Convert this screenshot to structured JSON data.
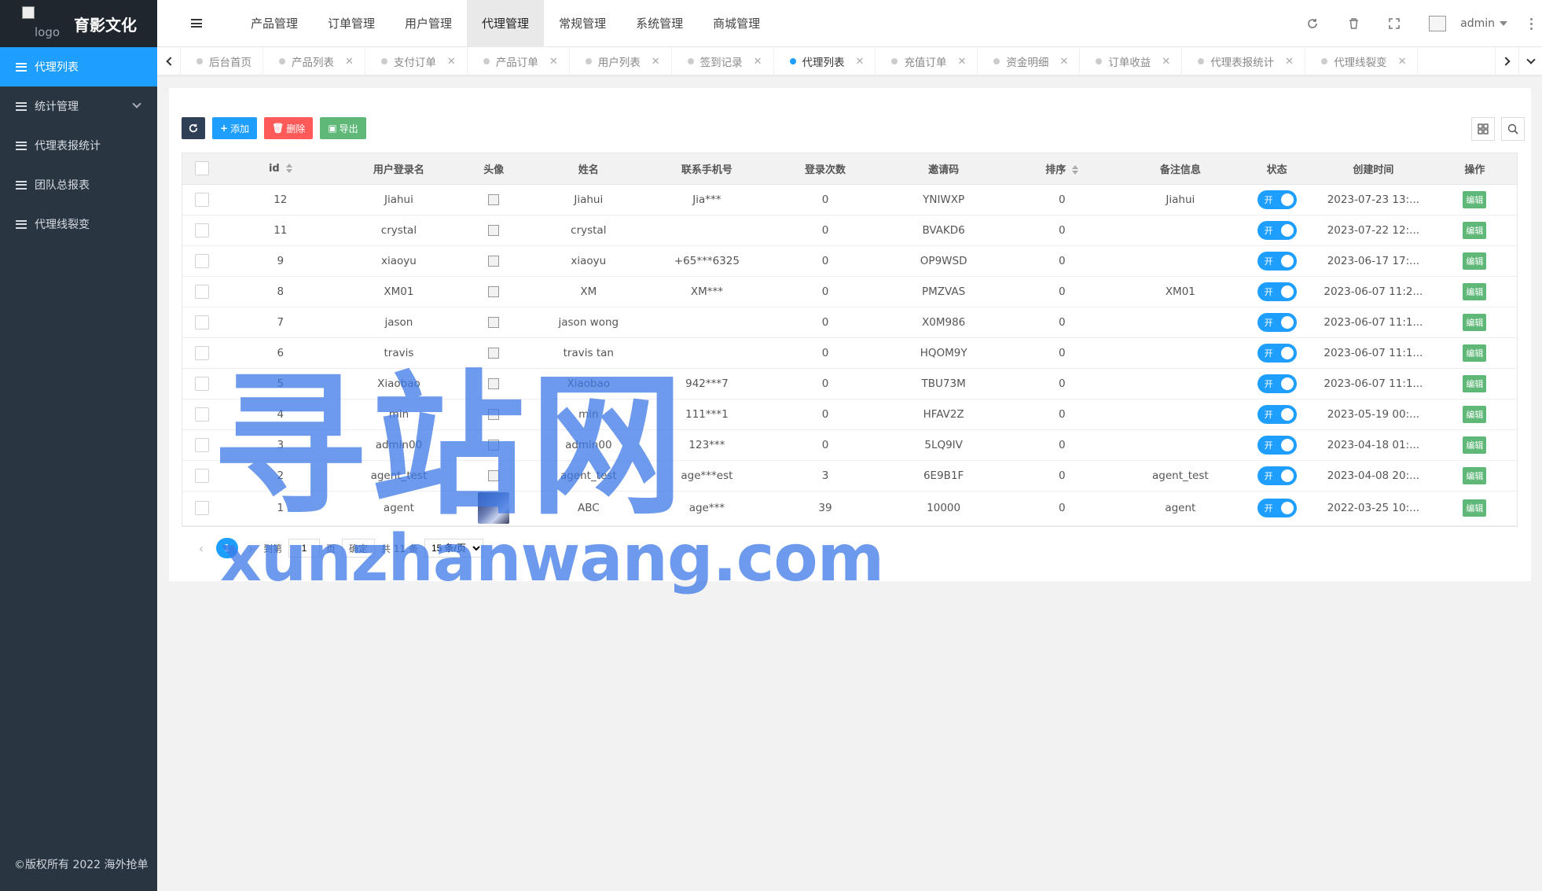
{
  "brand": {
    "logo_alt": "logo",
    "name": "育影文化"
  },
  "sidebar": {
    "items": [
      {
        "label": "代理列表",
        "active": true
      },
      {
        "label": "统计管理",
        "expandable": true
      },
      {
        "label": "代理表报统计"
      },
      {
        "label": "团队总报表"
      },
      {
        "label": "代理线裂变"
      }
    ],
    "copyright": "©版权所有 2022 海外抢单"
  },
  "topnav": {
    "items": [
      "产品管理",
      "订单管理",
      "用户管理",
      "代理管理",
      "常规管理",
      "系统管理",
      "商城管理"
    ],
    "active_index": 3
  },
  "header": {
    "username": "admin"
  },
  "tabs": [
    {
      "label": "后台首页",
      "closable": false
    },
    {
      "label": "产品列表",
      "closable": true
    },
    {
      "label": "支付订单",
      "closable": true
    },
    {
      "label": "产品订单",
      "closable": true
    },
    {
      "label": "用户列表",
      "closable": true
    },
    {
      "label": "签到记录",
      "closable": true
    },
    {
      "label": "代理列表",
      "closable": true,
      "active": true
    },
    {
      "label": "充值订单",
      "closable": true
    },
    {
      "label": "资金明细",
      "closable": true
    },
    {
      "label": "订单收益",
      "closable": true
    },
    {
      "label": "代理表报统计",
      "closable": true
    },
    {
      "label": "代理线裂变",
      "closable": true
    }
  ],
  "toolbar": {
    "add": "添加",
    "delete": "删除",
    "export": "导出"
  },
  "table": {
    "columns": [
      "id",
      "用户登录名",
      "头像",
      "姓名",
      "联系手机号",
      "登录次数",
      "邀请码",
      "排序",
      "备注信息",
      "状态",
      "创建时间",
      "操作"
    ],
    "switch_on_label": "开",
    "edit_label": "编辑",
    "rows": [
      {
        "id": "12",
        "login": "Jiahui",
        "avatar": "broken",
        "name": "Jiahui",
        "phone": "Jia***",
        "logins": "0",
        "code": "YNIWXP",
        "sort": "0",
        "remark": "Jiahui",
        "status": true,
        "created": "2023-07-23 13:..."
      },
      {
        "id": "11",
        "login": "crystal",
        "avatar": "broken",
        "name": "crystal",
        "phone": "",
        "logins": "0",
        "code": "BVAKD6",
        "sort": "0",
        "remark": "",
        "status": true,
        "created": "2023-07-22 12:..."
      },
      {
        "id": "9",
        "login": "xiaoyu",
        "avatar": "broken",
        "name": "xiaoyu",
        "phone": "+65***6325",
        "logins": "0",
        "code": "OP9WSD",
        "sort": "0",
        "remark": "",
        "status": true,
        "created": "2023-06-17 17:..."
      },
      {
        "id": "8",
        "login": "XM01",
        "avatar": "broken",
        "name": "XM",
        "phone": "XM***",
        "logins": "0",
        "code": "PMZVAS",
        "sort": "0",
        "remark": "XM01",
        "status": true,
        "created": "2023-06-07 11:2..."
      },
      {
        "id": "7",
        "login": "jason",
        "avatar": "broken",
        "name": "jason wong",
        "phone": "",
        "logins": "0",
        "code": "X0M986",
        "sort": "0",
        "remark": "",
        "status": true,
        "created": "2023-06-07 11:1..."
      },
      {
        "id": "6",
        "login": "travis",
        "avatar": "broken",
        "name": "travis tan",
        "phone": "",
        "logins": "0",
        "code": "HQOM9Y",
        "sort": "0",
        "remark": "",
        "status": true,
        "created": "2023-06-07 11:1..."
      },
      {
        "id": "5",
        "login": "Xiaobao",
        "avatar": "broken",
        "name": "Xiaobao",
        "phone": "942***7",
        "logins": "0",
        "code": "TBU73M",
        "sort": "0",
        "remark": "",
        "status": true,
        "created": "2023-06-07 11:1..."
      },
      {
        "id": "4",
        "login": "min",
        "avatar": "broken",
        "name": "min",
        "phone": "111***1",
        "logins": "0",
        "code": "HFAV2Z",
        "sort": "0",
        "remark": "",
        "status": true,
        "created": "2023-05-19 00:..."
      },
      {
        "id": "3",
        "login": "admin00",
        "avatar": "broken",
        "name": "admin00",
        "phone": "123***",
        "logins": "0",
        "code": "5LQ9IV",
        "sort": "0",
        "remark": "",
        "status": true,
        "created": "2023-04-18 01:..."
      },
      {
        "id": "2",
        "login": "agent_test",
        "avatar": "broken",
        "name": "agent_test",
        "phone": "age***est",
        "logins": "3",
        "code": "6E9B1F",
        "sort": "0",
        "remark": "agent_test",
        "status": true,
        "created": "2023-04-08 20:..."
      },
      {
        "id": "1",
        "login": "agent",
        "avatar": "image",
        "name": "ABC",
        "phone": "age***",
        "logins": "39",
        "code": "10000",
        "sort": "0",
        "remark": "agent",
        "status": true,
        "created": "2022-03-25 10:..."
      }
    ]
  },
  "pagination": {
    "current": "1",
    "goto_prefix": "到第",
    "goto_value": "1",
    "goto_suffix": "页",
    "confirm": "确定",
    "total": "共 11 条",
    "page_size": "15 条/页"
  },
  "watermark": {
    "cn": "寻站网",
    "en": "xunzhanwang.com"
  },
  "colors": {
    "accent": "#1e9fff",
    "sidebar": "#2a3542",
    "success": "#5fb878",
    "danger": "#ff5a5a"
  }
}
